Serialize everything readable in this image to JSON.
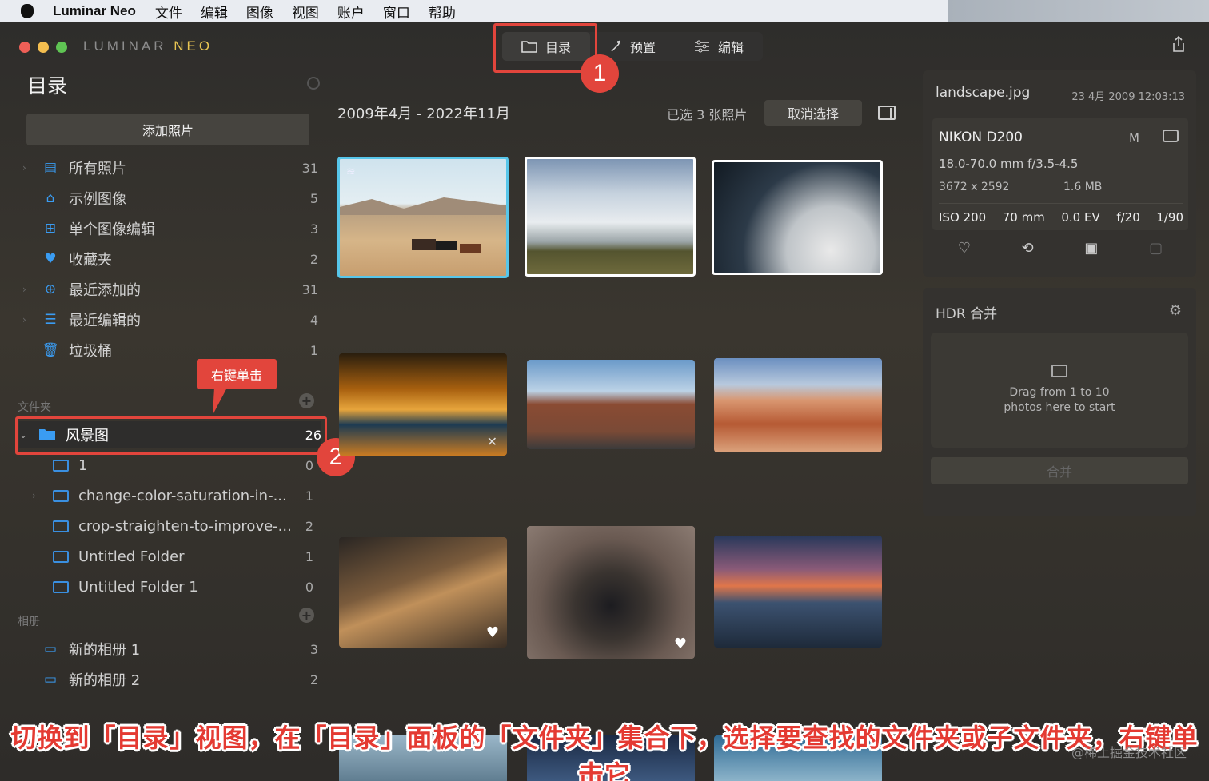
{
  "menubar": {
    "app": "Luminar Neo",
    "items": [
      "文件",
      "编辑",
      "图像",
      "视图",
      "账户",
      "窗口",
      "帮助"
    ]
  },
  "brand": {
    "left": "LUMINAR",
    "right": "NEO"
  },
  "topnav": {
    "catalog": "目录",
    "presets": "预置",
    "edit": "编辑"
  },
  "markers": {
    "one": "1",
    "two": "2"
  },
  "tooltip": "右键单击",
  "sidebar": {
    "title": "目录",
    "add_photos": "添加照片",
    "library": [
      {
        "label": "所有照片",
        "count": "31",
        "icon": "photos-icon"
      },
      {
        "label": "示例图像",
        "count": "5",
        "icon": "graduation-cap-icon"
      },
      {
        "label": "单个图像编辑",
        "count": "3",
        "icon": "grid-icon"
      },
      {
        "label": "收藏夹",
        "count": "2",
        "icon": "heart-icon"
      },
      {
        "label": "最近添加的",
        "count": "31",
        "icon": "plus-circle-icon"
      },
      {
        "label": "最近编辑的",
        "count": "4",
        "icon": "sliders-icon"
      },
      {
        "label": "垃圾桶",
        "count": "1",
        "icon": "trash-icon"
      }
    ],
    "folders_heading": "文件夹",
    "folder_root": {
      "label": "风景图",
      "count": "26"
    },
    "subfolders": [
      {
        "label": "1",
        "count": "0"
      },
      {
        "label": "change-color-saturation-in-...",
        "count": "1"
      },
      {
        "label": "crop-straighten-to-improve-...",
        "count": "2"
      },
      {
        "label": "Untitled Folder",
        "count": "1"
      },
      {
        "label": "Untitled Folder 1",
        "count": "0"
      }
    ],
    "albums_heading": "相册",
    "albums": [
      {
        "label": "新的相册 1",
        "count": "3"
      },
      {
        "label": "新的相册 2",
        "count": "2"
      }
    ]
  },
  "main": {
    "date_range": "2009年4月 - 2022年11月",
    "selected": "已选 3 张照片",
    "deselect": "取消选择"
  },
  "info": {
    "filename": "landscape.jpg",
    "date": "23 4月 2009 12:03:13",
    "camera": "NIKON D200",
    "mode": "M",
    "lens": "18.0-70.0 mm f/3.5-4.5",
    "dimensions": "3672 x 2592",
    "filesize": "1.6 MB",
    "exif": [
      "ISO 200",
      "70 mm",
      "0.0 EV",
      "f/20",
      "1/90"
    ]
  },
  "hdr": {
    "title": "HDR 合并",
    "drop_line1": "Drag from 1 to 10",
    "drop_line2": "photos here to start",
    "merge": "合并"
  },
  "caption": "切换到「目录」视图，在「目录」面板的「文件夹」集合下，选择要查找的文件夹或子文件夹，右键单击它",
  "watermark": "@稀土掘金技术社区",
  "colors": {
    "accent_red": "#e2453c",
    "folder_blue": "#3a9cf2",
    "selected_border": "#57c6ea"
  }
}
